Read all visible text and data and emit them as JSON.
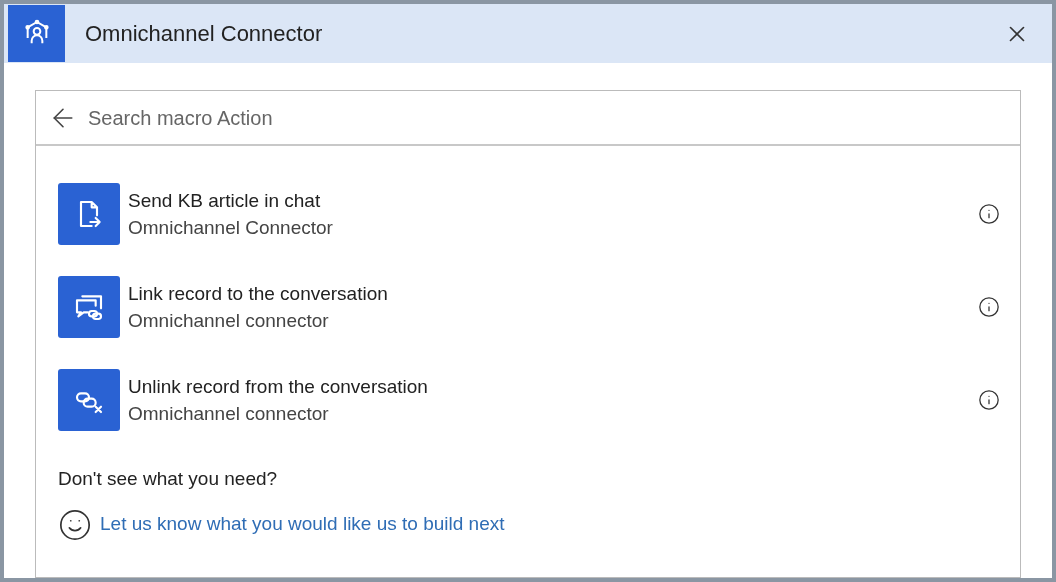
{
  "header": {
    "title": "Omnichannel Connector"
  },
  "search": {
    "placeholder": "Search macro Action"
  },
  "actions": [
    {
      "kind": "document",
      "title": "Send KB article in chat",
      "subtitle": "Omnichannel Connector"
    },
    {
      "kind": "link",
      "title": "Link record to the conversation",
      "subtitle": "Omnichannel connector"
    },
    {
      "kind": "unlink",
      "title": "Unlink record from the conversation",
      "subtitle": "Omnichannel connector"
    }
  ],
  "footer": {
    "question": "Don't see what you need?",
    "link": "Let us know what you would like us to build next"
  }
}
